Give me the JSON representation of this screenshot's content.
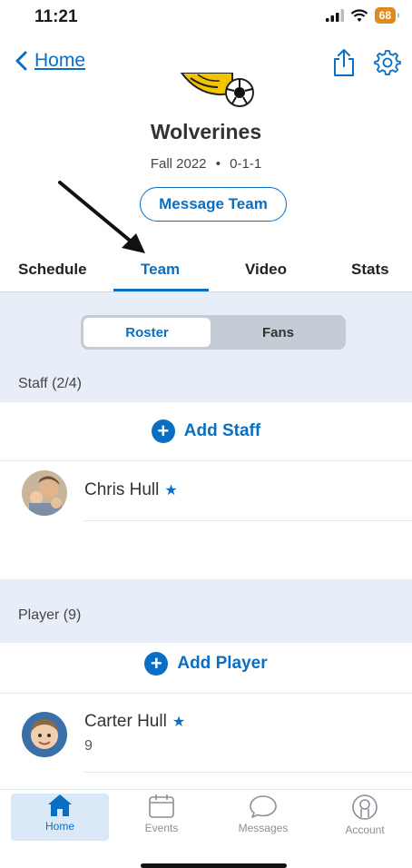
{
  "status_bar": {
    "time": "11:21",
    "battery": "68"
  },
  "nav": {
    "back_label": "Home"
  },
  "team": {
    "name": "Wolverines",
    "season": "Fall 2022",
    "record": "0-1-1",
    "separator": "•"
  },
  "message_team_label": "Message Team",
  "tabs": [
    {
      "label": "Schedule",
      "active": false
    },
    {
      "label": "Team",
      "active": true
    },
    {
      "label": "Video",
      "active": false
    },
    {
      "label": "Stats",
      "active": false
    }
  ],
  "segments": {
    "roster": "Roster",
    "fans": "Fans",
    "selected": "Roster"
  },
  "staff": {
    "header": "Staff (2/4)",
    "add_label": "Add Staff",
    "members": [
      {
        "name": "Chris Hull",
        "starred": true
      }
    ]
  },
  "players": {
    "header": "Player (9)",
    "add_label": "Add Player",
    "members": [
      {
        "name": "Carter Hull",
        "number": "9",
        "starred": true
      }
    ]
  },
  "bottom_nav": [
    {
      "label": "Home",
      "icon": "home-icon",
      "active": true
    },
    {
      "label": "Events",
      "icon": "calendar-icon",
      "active": false
    },
    {
      "label": "Messages",
      "icon": "chat-bubble-icon",
      "active": false
    },
    {
      "label": "Account",
      "icon": "account-icon",
      "active": false
    }
  ],
  "colors": {
    "accent": "#0a6fc2",
    "section_bg": "#e8eef7",
    "battery": "#e08a1e"
  }
}
